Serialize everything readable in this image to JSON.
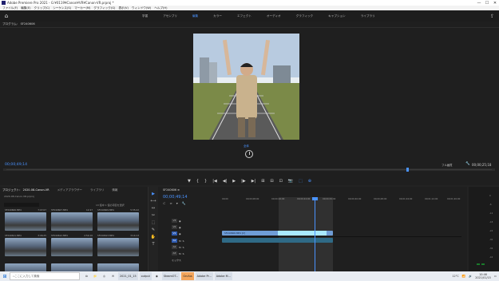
{
  "window": {
    "title": "Adobe Premiere Pro 2021 - G:¥0119¥Canon¥VR¥Canon-VR.prproj *",
    "controls": [
      "—",
      "☐",
      "✕"
    ]
  },
  "menu": [
    "ファイル(F)",
    "編集(E)",
    "クリップ(C)",
    "シーケンス(S)",
    "マーカー(M)",
    "グラフィック(G)",
    "表示(V)",
    "ウィンドウ(W)",
    "ヘルプ(H)"
  ],
  "workspace": {
    "tabs": [
      "学習",
      "アセンブリ",
      "編集",
      "カラー",
      "エフェクト",
      "オーディオ",
      "グラフィック",
      "キャプション",
      "ライブラリ"
    ],
    "active_index": 2
  },
  "program": {
    "header": "プログラム：  SF240606",
    "zoom": "全体",
    "timecode_left": "00;00;49;14",
    "fit": "フル画質",
    "timecode_right": "00;00;25;18",
    "vr_left": "",
    "vr_right": "",
    "progress": 0.82
  },
  "transport": {
    "buttons": [
      "▼",
      "{",
      "}",
      "|◀",
      "◀|",
      "▶",
      "|▶",
      "▶|",
      "⊞",
      "⊟",
      "⊡",
      "📷",
      "⬚",
      "⊕"
    ]
  },
  "project": {
    "tabs": [
      "プロジェクト：  2020-08-Canon-VR",
      "メディアブラウザー",
      "ライブラリ",
      "情報"
    ],
    "path": "2020-08-Canon-VR.prproj",
    "count": "13 個中 1 個の項目を選択",
    "clips": [
      {
        "name": "SF240606.MP4",
        "duration": "7:47;07"
      },
      {
        "name": "SF240607.MP4",
        "duration": "12:27"
      },
      {
        "name": "SF240609.MP4",
        "duration": "5:35;22"
      },
      {
        "name": "SF240611.MP4",
        "duration": "3:46;25"
      },
      {
        "name": "SF240612.MP4",
        "duration": "2:54;16"
      },
      {
        "name": "SF240613.MP4",
        "duration": "3:14;13"
      },
      {
        "name": "",
        "duration": ""
      },
      {
        "name": "",
        "duration": ""
      },
      {
        "name": "",
        "duration": ""
      }
    ]
  },
  "tools": [
    "▶",
    "⟷",
    "↔",
    "✂",
    "⬚",
    "✎",
    "✋",
    "T"
  ],
  "timeline": {
    "tab": "SF240606  ≡",
    "timecode": "00;00;49;14",
    "ruler": [
      "00;00",
      "00;00;08;00",
      "00;00;16;00",
      "00;00;24;00",
      "00;00;32;00",
      "00;00;40;00",
      "00;00;48;00",
      "00;01;04;00",
      "00;01;12;00",
      "00;01;20;00"
    ],
    "tracks": [
      {
        "name": "V3",
        "toggles": [
          "V3",
          "◉"
        ]
      },
      {
        "name": "V2",
        "toggles": [
          "V2",
          "◉"
        ]
      },
      {
        "name": "V1",
        "toggles": [
          "V1",
          "◉"
        ]
      },
      {
        "name": "A1",
        "toggles": [
          "A1",
          "M",
          "S"
        ]
      },
      {
        "name": "A2",
        "toggles": [
          "A2",
          "M",
          "S"
        ]
      },
      {
        "name": "A3",
        "toggles": [
          "A3",
          "M",
          "S"
        ]
      }
    ],
    "master": "ミックス",
    "clip_name": "SF240606.MP4 [V]"
  },
  "meter": {
    "scale": [
      "0",
      "-6",
      "-12",
      "-18",
      "-24",
      "-30",
      "-36",
      "-42",
      "-48",
      "dB"
    ]
  },
  "taskbar": {
    "search_placeholder": "ここに入力して検索",
    "apps": [
      "2021_01_15",
      "output",
      "SteamOT...",
      "Grufus",
      "Adobe Pr...",
      "Adobe M..."
    ],
    "temp": "12°C",
    "time": "10:46",
    "date": "2021/01/15"
  },
  "colors": {
    "accent": "#4a93ff",
    "clip_video": "#6f9dd6",
    "clip_selected": "#a9e9ff",
    "clip_audio": "#2f6a86",
    "taskbar_highlight": "#f3a55c"
  }
}
